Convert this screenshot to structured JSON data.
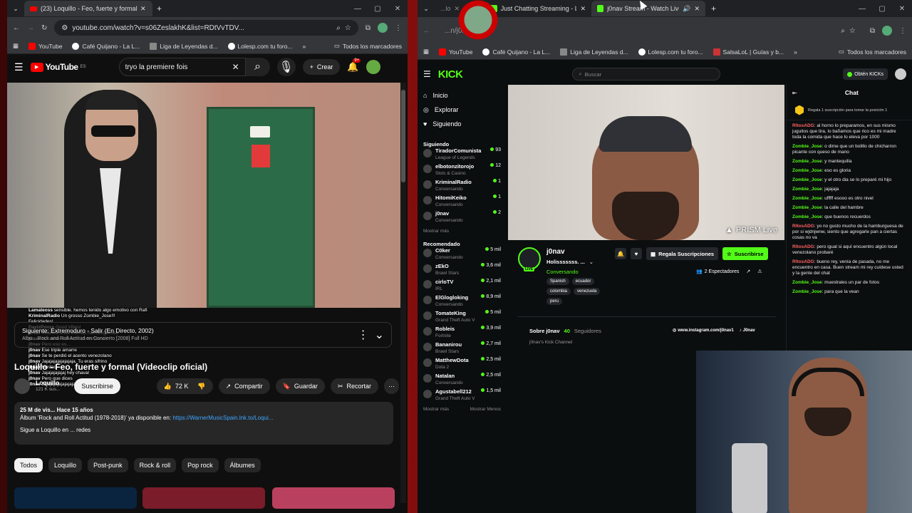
{
  "left": {
    "tab_title": "(23) Loquillo - Feo, fuerte y formal",
    "url": "youtube.com/watch?v=s06ZeslakhK&list=RDtVvTDV...",
    "bookmarks": [
      "YouTube",
      "Café Quijano - La L...",
      "Liga de Leyendas d...",
      "Lolesp.com tu foro...",
      "Todos los marcadores"
    ],
    "yt": {
      "logo": "YouTube",
      "logo_region": "ES",
      "search_value": "tryo la premiere fois",
      "create_label": "Crear",
      "notif_badge": "9+",
      "next_label": "Siguiente: Extremoduro - Salir (En Directo, 2002)",
      "next_sub": "Albu... Rock and Roll Actitud en Concierto [2008] Full HD",
      "title": "Loquillo - Feo, fuerte y formal (Videoclip oficial)",
      "channel": "Loquillo",
      "subs": "121 K sus...",
      "subscribe_label": "Suscribirse",
      "likes": "72 K",
      "share_label": "Compartir",
      "save_label": "Guardar",
      "clip_label": "Recortar",
      "desc_date": "25 M de vis... Hace 15 años",
      "desc_line": "Álbum 'Rock and Roll Actitud (1978-2018)' ya disponible en:",
      "desc_link": "https://WarnerMusicSpain.lnk.to/Loqui...",
      "desc_follow": "Sigue a Loquillo en ... redes",
      "chips": [
        "Todos",
        "Loquillo",
        "Post-punk",
        "Rock & roll",
        "Pop rock",
        "Álbumes"
      ]
    }
  },
  "right": {
    "tabs": [
      {
        "title": "...lo"
      },
      {
        "title": "Just Chatting Streaming - Live S"
      },
      {
        "title": "j0nav Stream - Watch Live o"
      }
    ],
    "url": "...n/j0nav",
    "bookmarks": [
      "YouTube",
      "Café Quijano - La L...",
      "Liga de Leyendas d...",
      "Lolesp.com tu foro...",
      "SalsaLoL | Guías y b...",
      "Todos los marcadores"
    ],
    "kick": {
      "logo": "KICK",
      "search_placeholder": "Buscar",
      "get_kicks": "Obtén KICKs",
      "nav": [
        "Inicio",
        "Explorar",
        "Siguiendo"
      ],
      "following_label": "Siguiendo",
      "following": [
        {
          "name": "TiradorComunista",
          "cat": "League of Legends",
          "viewers": "93"
        },
        {
          "name": "elbotonzitorojo",
          "cat": "Slots & Casino",
          "viewers": "12"
        },
        {
          "name": "KriminalRadio",
          "cat": "Conversando",
          "viewers": "1"
        },
        {
          "name": "HitomiKeiko",
          "cat": "Conversando",
          "viewers": "1"
        },
        {
          "name": "j0nav",
          "cat": "Conversando",
          "viewers": "2"
        }
      ],
      "show_more": "Mostrar más",
      "recommended_label": "Recomendado",
      "recommended": [
        {
          "name": "C0ker",
          "cat": "Conversando",
          "viewers": "5 mil"
        },
        {
          "name": "zEkO",
          "cat": "Brawl Stars",
          "viewers": "3,6 mil"
        },
        {
          "name": "cirloTV",
          "cat": "IRL",
          "viewers": "2,1 mil"
        },
        {
          "name": "ElGlogloking",
          "cat": "Conversando",
          "viewers": "8,9 mil"
        },
        {
          "name": "TomateKing",
          "cat": "Grand Theft Auto V",
          "viewers": "5 mil"
        },
        {
          "name": "Robleis",
          "cat": "Fortnite",
          "viewers": "3,9 mil"
        },
        {
          "name": "Bananirou",
          "cat": "Brawl Stars",
          "viewers": "2,7 mil"
        },
        {
          "name": "MatthewDota",
          "cat": "Dota 2",
          "viewers": "2,5 mil"
        },
        {
          "name": "Natalan",
          "cat": "Conversando",
          "viewers": "2,5 mil"
        },
        {
          "name": "Agustabell212",
          "cat": "Grand Theft Auto V",
          "viewers": "1,5 mil"
        }
      ],
      "show_more2": "Mostrar más",
      "show_less": "Mostrar Menos",
      "watermark": "PRISM Live",
      "streamer": "j0nav",
      "stream_title": "Holisssssss. ...",
      "stream_cat": "Conversando",
      "tags": [
        "Spanish",
        "ecuador",
        "colombia",
        "venezuela",
        "peru"
      ],
      "gift_subs": "Regala Suscripciones",
      "subscribe": "Suscribirse",
      "viewers": "2 Espectadores",
      "about_label": "Sobre j0nav",
      "followers_num": "40",
      "followers_label": "Seguidores",
      "about_desc": "j0nav's Kick Channel",
      "insta": "www.instagram.com/j0nav1",
      "tiktok": "J0nav",
      "chat_title": "Chat",
      "pinned": "Regala 1 suscripción para tomar la posición 1",
      "chat": [
        {
          "user": "RltosADG",
          "text": "al horno lo preparamos, en sus mismo juguitos que tira, lo bañamos que rico es mi madre toda la comida que hace lo eleva por 1000"
        },
        {
          "user": "Zombie_Jose",
          "text": "o dime que un bolillo de chicharron picante con queso de mano"
        },
        {
          "user": "Zombie_Jose",
          "text": "y mantequilla"
        },
        {
          "user": "Zombie_Jose",
          "text": "eso es gloria"
        },
        {
          "user": "Zombie_Jose",
          "text": "y el otro dia se lo preparé mi hijo"
        },
        {
          "user": "Zombie_Jose",
          "text": "jajajaja"
        },
        {
          "user": "Zombie_Jose",
          "text": "ufffff esooo es otro nivel"
        },
        {
          "user": "Zombie_Jose",
          "text": "la calle del hambre"
        },
        {
          "user": "Zombie_Jose",
          "text": "que buenos recuerdos"
        },
        {
          "user": "RltosADG",
          "text": "yo no gusto mucho de la hamburguesa de por si wjdnjwnw, siento que agregarle pan a ciertas cosas no va"
        },
        {
          "user": "RltosADG",
          "text": "pero igual si aquí encuentro algún local venezolano probaré"
        },
        {
          "user": "RltosADG",
          "text": "bueno rey, venía de pasada, no me encuentro en casa. Buen stream mi rey cuídese usted y la gente del chat"
        },
        {
          "user": "Zombie_Jose",
          "text": "muestrales un par de fotos"
        },
        {
          "user": "Zombie_Jose",
          "text": "para que la vean"
        }
      ]
    }
  },
  "overlay_chat": [
    {
      "user": "Lamateoss",
      "text": "sensible. hemos tenido algo emotivo con Rafi"
    },
    {
      "user": "KriminalRadio",
      "text": "Un grosso Zombie_Jose!!!"
    },
    {
      "user": "",
      "text": "Felicidades!"
    },
    {
      "user": "DavizPonze",
      "text": "Good Vibes!"
    },
    {
      "user": "j0nav",
      "text": "Muestra unas buenas hamburguesas"
    },
    {
      "user": "j0nav",
      "text": "No vallas a decir... Venezolana"
    },
    {
      "user": "j0nav",
      "text": "Pero eso es..."
    },
    {
      "user": "j0nav",
      "text": "Ese triple amarre"
    },
    {
      "user": "j0nav",
      "text": "Se te perdió el acento venezolano"
    },
    {
      "user": "j0nav",
      "text": "Jajajajajajajajaja. Tu eras sifrino"
    },
    {
      "user": "j0nav",
      "text": "Verdad"
    },
    {
      "user": "j0nav",
      "text": "Jajajajajajaj hey chaval"
    },
    {
      "user": "j0nav",
      "text": "Pero que dices"
    },
    {
      "user": "j0nav",
      "text": "Jajajajajajajajaja"
    }
  ],
  "colors": {
    "kick_green": "#53fc18",
    "yt_red": "#ff0000",
    "chat_red": "#ff6262"
  }
}
